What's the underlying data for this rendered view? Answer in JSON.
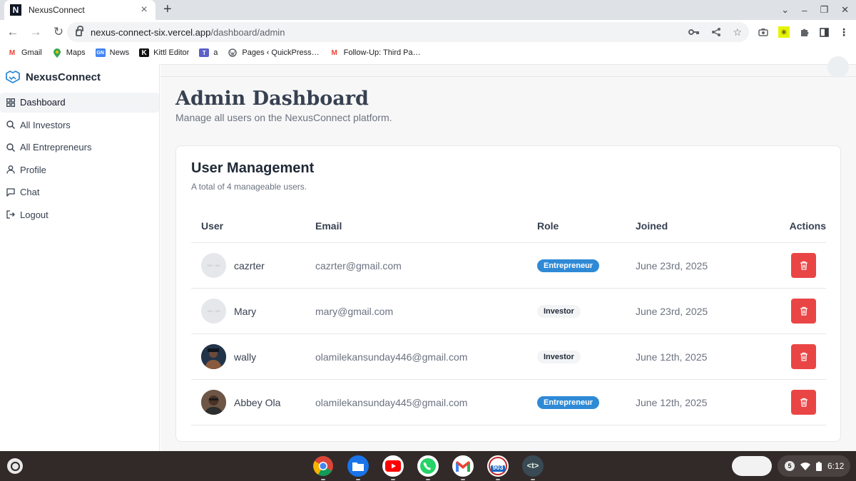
{
  "browser": {
    "tab_title": "NexusConnect",
    "tab_favicon": "N",
    "url_host": "nexus-connect-six.vercel.app",
    "url_path": "/dashboard/admin",
    "bookmarks": [
      {
        "label": "Gmail",
        "icon": "gmail-icon"
      },
      {
        "label": "Maps",
        "icon": "maps-icon"
      },
      {
        "label": "News",
        "icon": "news-icon"
      },
      {
        "label": "Kittl Editor",
        "icon": "kittl-icon"
      },
      {
        "label": "a",
        "icon": "teams-icon"
      },
      {
        "label": "Pages ‹ QuickPress…",
        "icon": "wordpress-icon"
      },
      {
        "label": "Follow-Up: Third Pa…",
        "icon": "gmail-icon"
      }
    ]
  },
  "sidebar": {
    "brand": "NexusConnect",
    "items": [
      {
        "label": "Dashboard",
        "icon": "grid-icon",
        "active": true
      },
      {
        "label": "All Investors",
        "icon": "search-icon"
      },
      {
        "label": "All Entrepreneurs",
        "icon": "search-icon"
      },
      {
        "label": "Profile",
        "icon": "user-icon"
      },
      {
        "label": "Chat",
        "icon": "chat-icon"
      },
      {
        "label": "Logout",
        "icon": "logout-icon"
      }
    ]
  },
  "main": {
    "title": "Admin Dashboard",
    "subtitle": "Manage all users on the NexusConnect platform."
  },
  "card": {
    "title": "User Management",
    "subtitle": "A total of 4 manageable users.",
    "columns": [
      "User",
      "Email",
      "Role",
      "Joined",
      "Actions"
    ],
    "rows": [
      {
        "name": "cazrter",
        "email": "cazrter@gmail.com",
        "role": "Entrepreneur",
        "joined": "June 23rd, 2025",
        "avatar": "placeholder",
        "avatar_text": "300 × 300"
      },
      {
        "name": "Mary",
        "email": "mary@gmail.com",
        "role": "Investor",
        "joined": "June 23rd, 2025",
        "avatar": "placeholder",
        "avatar_text": "300 × 300"
      },
      {
        "name": "wally",
        "email": "olamilekansunday446@gmail.com",
        "role": "Investor",
        "joined": "June 12th, 2025",
        "avatar": "photo"
      },
      {
        "name": "Abbey Ola",
        "email": "olamilekansunday445@gmail.com",
        "role": "Entrepreneur",
        "joined": "June 12th, 2025",
        "avatar": "photo"
      }
    ]
  },
  "shelf": {
    "apps": [
      "chrome-icon",
      "files-icon",
      "youtube-icon",
      "whatsapp-icon",
      "gmail-icon",
      "radio-icon",
      "terminal-icon"
    ],
    "radio_label": "903",
    "terminal_label": "<t>",
    "notification_count": "5",
    "time": "6:12"
  },
  "colors": {
    "accent_blue": "#2f8ad6",
    "danger_red": "#ea4545",
    "content_bg": "#f7f7f7"
  }
}
